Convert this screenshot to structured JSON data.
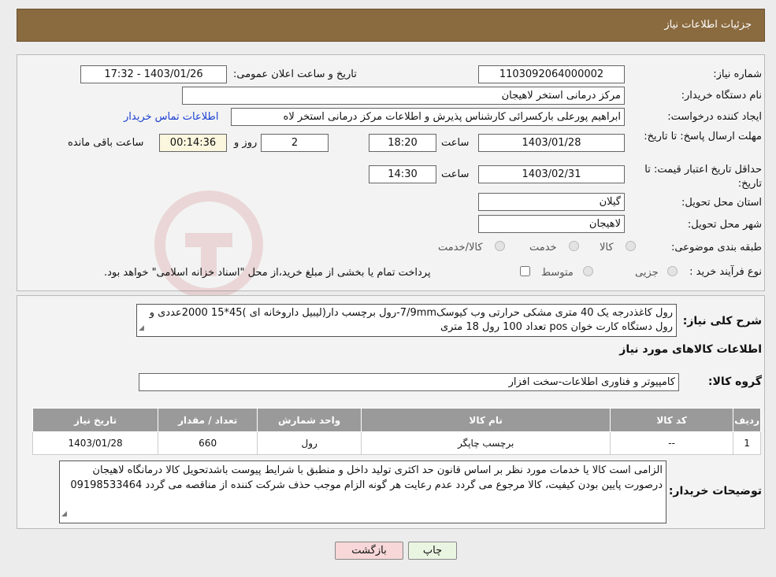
{
  "header": {
    "title": "جزئیات اطلاعات نیاز"
  },
  "info": {
    "need_number_label": "شماره نیاز:",
    "need_number": "1103092064000002",
    "announce_label": "تاریخ و ساعت اعلان عمومی:",
    "announce_value": "1403/01/26 - 17:32",
    "buyer_org_label": "نام دستگاه خریدار:",
    "buyer_org": "مرکز درمانی استخر لاهیجان",
    "creator_label": "ایجاد کننده درخواست:",
    "creator": "ابراهیم پورعلی بارکسرائی کارشناس پذیرش و اطلاعات مرکز درمانی استخر لاه",
    "contact_link": "اطلاعات تماس خریدار",
    "deadline_label": "مهلت ارسال پاسخ: تا تاریخ:",
    "deadline_date": "1403/01/28",
    "time_label": "ساعت",
    "deadline_time": "18:20",
    "days_value": "2",
    "days_label": "روز و",
    "remaining_time": "00:14:36",
    "remaining_label": "ساعت باقی مانده",
    "validity_label": "حداقل تاریخ اعتبار قیمت: تا تاریخ:",
    "validity_date": "1403/02/31",
    "validity_time": "14:30",
    "province_label": "استان محل تحویل:",
    "province": "گیلان",
    "city_label": "شهر محل تحویل:",
    "city": "لاهیجان",
    "category_label": "طبقه بندی موضوعی:",
    "category_options": [
      "کالا",
      "خدمت",
      "کالا/خدمت"
    ],
    "process_label": "نوع فرآیند خرید :",
    "process_options": [
      "جزیی",
      "متوسط"
    ],
    "process_note": "پرداخت تمام یا بخشی از مبلغ خرید،از محل \"اسناد خزانه اسلامی\" خواهد بود."
  },
  "description": {
    "label": "شرح کلی نیاز:",
    "text": "رول کاغذدرجه یک 40 متری مشکی حرارتی وب کیوسک7/9mm-رول برچسب دار(لیبیل داروخانه ای )45*15 2000عددی و رول دستگاه کارت خوان pos تعداد 100 رول 18 متری"
  },
  "goods": {
    "section_title": "اطلاعات کالاهای مورد نیاز",
    "group_label": "گروه کالا:",
    "group_value": "کامپیوتر و فناوری اطلاعات-سخت افزار",
    "columns": [
      "ردیف",
      "کد کالا",
      "نام کالا",
      "واحد شمارش",
      "تعداد / مقدار",
      "تاریخ نیاز"
    ],
    "rows": [
      [
        "1",
        "--",
        "برچسب چاپگر",
        "رول",
        "660",
        "1403/01/28"
      ]
    ]
  },
  "notes": {
    "label": "توضیحات خریدار:",
    "text": "الزامی است کالا یا خدمات مورد نظر بر اساس قانون حد اکثری تولید داخل و منطبق با شرایط پیوست باشدتحویل کالا درمانگاه  لاهیجان درصورت پایین بودن کیفیت، کالا مرجوع می گردد عدم رعایت هر گونه الزام موجب حذف شرکت کننده از مناقصه می گردد 09198533464"
  },
  "buttons": {
    "print": "چاپ",
    "back": "بازگشت"
  },
  "colors": {
    "header_bg": "#8a6a3f",
    "link": "#1a3fd1",
    "back_button_bg": "#f7d7d7",
    "print_button_bg": "#eaf5e1"
  }
}
